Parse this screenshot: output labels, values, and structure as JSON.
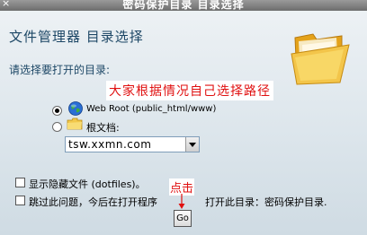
{
  "window": {
    "title": "密码保护目录 目录选择",
    "close_glyph": "×"
  },
  "page": {
    "heading": "文件管理器  目录选择",
    "prompt": "请选择要打开的目录:"
  },
  "options": {
    "web_root_label": "Web Root (public_html/www)",
    "root_doc_label": "根文档:",
    "domain_select_value": "tsw.xxmn.com"
  },
  "checkboxes": {
    "show_hidden_label": "显示隐藏文件 (dotfiles)。",
    "skip_question_part1": "跳过此问题，今后在打开程序",
    "skip_question_part2": "打开此目录：密码保护目录."
  },
  "buttons": {
    "go_label": "Go"
  },
  "annotations": {
    "choose_path_note": "大家根据情况自己选择路径",
    "click_note": "点击"
  },
  "colors": {
    "annotation_red": "#e01010",
    "heading_blue": "#1d4766"
  }
}
